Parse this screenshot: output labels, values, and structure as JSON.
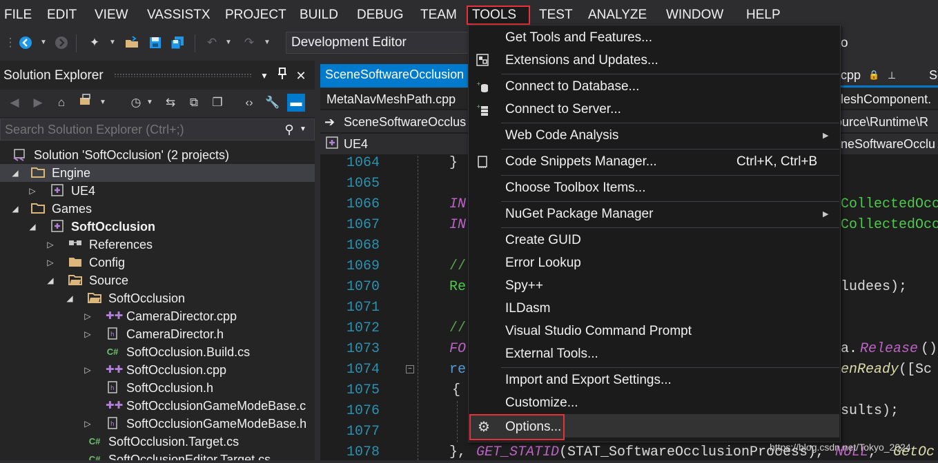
{
  "menubar": {
    "items": [
      "FILE",
      "EDIT",
      "VIEW",
      "VASSISTX",
      "PROJECT",
      "BUILD",
      "DEBUG",
      "TEAM",
      "TOOLS",
      "TEST",
      "ANALYZE",
      "WINDOW",
      "HELP"
    ]
  },
  "toolbar": {
    "configuration": "Development Editor"
  },
  "solution_explorer": {
    "title": "Solution Explorer",
    "search_placeholder": "Search Solution Explorer (Ctrl+;)",
    "tree": [
      {
        "label": "Solution 'SoftOcclusion' (2 projects)"
      },
      {
        "label": "Engine"
      },
      {
        "label": "UE4"
      },
      {
        "label": "Games"
      },
      {
        "label": "SoftOcclusion"
      },
      {
        "label": "References"
      },
      {
        "label": "Config"
      },
      {
        "label": "Source"
      },
      {
        "label": "SoftOcclusion"
      },
      {
        "label": "CameraDirector.cpp"
      },
      {
        "label": "CameraDirector.h"
      },
      {
        "label": "SoftOcclusion.Build.cs"
      },
      {
        "label": "SoftOcclusion.cpp"
      },
      {
        "label": "SoftOcclusion.h"
      },
      {
        "label": "SoftOcclusionGameModeBase.c"
      },
      {
        "label": "SoftOcclusionGameModeBase.h"
      },
      {
        "label": "SoftOcclusion.Target.cs"
      },
      {
        "label": "SoftOcclusionEditor.Target.cs"
      }
    ]
  },
  "editor": {
    "active_tab": "SceneSoftwareOcclusion",
    "second_tab": "MetaNavMeshPath.cpp",
    "nav_file": "SceneSoftwareOcclus",
    "nav_project": "UE4",
    "right_tab_fragment": "cpp",
    "right_tab_fragment2": "Sc",
    "right_tab2_fragment": "leshComponent.",
    "right_nav_fragment": "ource\\Runtime\\R",
    "right_nav2_fragment": "neSoftwareOcclu",
    "right_toolbar_fragment": "o",
    "line_numbers": [
      "1064",
      "1065",
      "1066",
      "1067",
      "1068",
      "1069",
      "1070",
      "1071",
      "1072",
      "1073",
      "1074",
      "1075",
      "1076",
      "1077",
      "1078"
    ],
    "code_left": {
      "l1064": "}",
      "l1066": "IN",
      "l1067": "IN",
      "l1069": "//",
      "l1070": "Re",
      "l1072": "//",
      "l1073": "FO",
      "l1074": "re",
      "l1075": "{",
      "l1078a": "},",
      "l1078b": "GET_STATID",
      "l1078c": "(STAT_SoftwareOcclusionProcess),",
      "l1078d": "NULL",
      "l1078e": ",",
      "l1078f": "GetOc"
    },
    "code_right": {
      "l1066": "CollectedOcc",
      "l1067": "CollectedOcc",
      "l1070": "ludees);",
      "l1073a": "a.",
      "l1073b": "Release",
      "l1073c": "()",
      "l1074a": "enReady",
      "l1074b": "([Sc",
      "l1076": "sults);"
    }
  },
  "tools_menu": {
    "items": [
      {
        "label": "Get Tools and Features..."
      },
      {
        "label": "Extensions and Updates...",
        "icon": "extensions-icon"
      },
      {
        "label": "Connect to Database...",
        "icon": "database-icon"
      },
      {
        "label": "Connect to Server...",
        "icon": "server-icon"
      },
      {
        "label": "Web Code Analysis",
        "submenu": true
      },
      {
        "label": "Code Snippets Manager...",
        "shortcut": "Ctrl+K, Ctrl+B",
        "icon": "snippet-icon"
      },
      {
        "label": "Choose Toolbox Items..."
      },
      {
        "label": "NuGet Package Manager",
        "submenu": true
      },
      {
        "label": "Create GUID"
      },
      {
        "label": "Error Lookup"
      },
      {
        "label": "Spy++"
      },
      {
        "label": "ILDasm"
      },
      {
        "label": "Visual Studio Command Prompt"
      },
      {
        "label": "External Tools..."
      },
      {
        "label": "Import and Export Settings..."
      },
      {
        "label": "Customize..."
      },
      {
        "label": "Options...",
        "icon": "gear-icon"
      }
    ]
  },
  "watermark": "https://blog.csdn.net/Tokyo_2024",
  "colors": {
    "accent": "#007acc",
    "highlight_border": "#e8313a",
    "line_number": "#2b91af",
    "macro": "#bd63c5",
    "comment": "#57a64a"
  }
}
